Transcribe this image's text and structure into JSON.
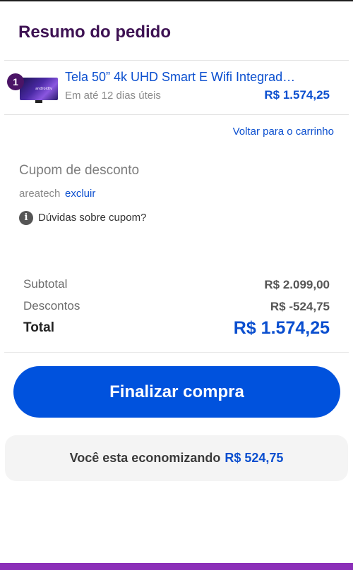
{
  "page_title": "Resumo do pedido",
  "product": {
    "quantity": "1",
    "name": "Tela 50” 4k UHD Smart E Wifi Integrad…",
    "delivery": "Em até 12 dias úteis",
    "price": "R$ 1.574,25",
    "thumb_brand": "androidtv"
  },
  "back_link": "Voltar para o carrinho",
  "coupon": {
    "title": "Cupom de desconto",
    "code": "areatech",
    "remove_label": "excluir",
    "help_label": "Dúvidas sobre cupom?",
    "help_icon": "info-icon"
  },
  "summary": {
    "subtotal_label": "Subtotal",
    "subtotal_value": "R$ 2.099,00",
    "discount_label": "Descontos",
    "discount_value": "R$ -524,75",
    "total_label": "Total",
    "total_value": "R$ 1.574,25"
  },
  "checkout_button": "Finalizar compra",
  "savings": {
    "text": "Você esta economizando",
    "amount": "R$ 524,75"
  },
  "colors": {
    "brand_purple": "#3d1152",
    "accent_blue": "#0052dd",
    "link_blue": "#0b4fcf",
    "bottom_bar": "#8b2fb8"
  }
}
